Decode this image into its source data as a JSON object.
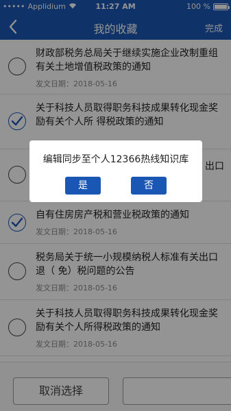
{
  "status_bar": {
    "carrier": "Applidium",
    "time": "11:27 AM",
    "battery": "100 %"
  },
  "nav": {
    "title": "我的收藏",
    "done_label": "完成"
  },
  "items": [
    {
      "text": "财政部税务总局关于继续实施企业改制重组有关土地增值税政策的通知",
      "date": "发文日期：2018-05-16",
      "checked": false
    },
    {
      "text": "关于科技人员取得职务科技成果转化现金奖励有关个人所 得税政策的通知",
      "date": "",
      "checked": true
    },
    {
      "text": "出口",
      "date": "",
      "checked": false
    },
    {
      "text": "自有住房房产税和营业税政策的通知",
      "date": "发文日期：2018-05-16",
      "checked": true
    },
    {
      "text": "税务局关于统一小规模纳税人标准有关出口退（ 免）税问题的公告",
      "date": "发文日期：2018-05-16",
      "checked": false
    },
    {
      "text": "关于科技人员取得职务科技成果转化现金奖励有关个人所得税政策的通知",
      "date": "发文日期：2018-05-16",
      "checked": false
    }
  ],
  "dialog": {
    "message": "编辑同步至个人12366热线知识库",
    "yes_label": "是",
    "no_label": "否"
  },
  "bottom": {
    "cancel_label": "取消选择"
  }
}
